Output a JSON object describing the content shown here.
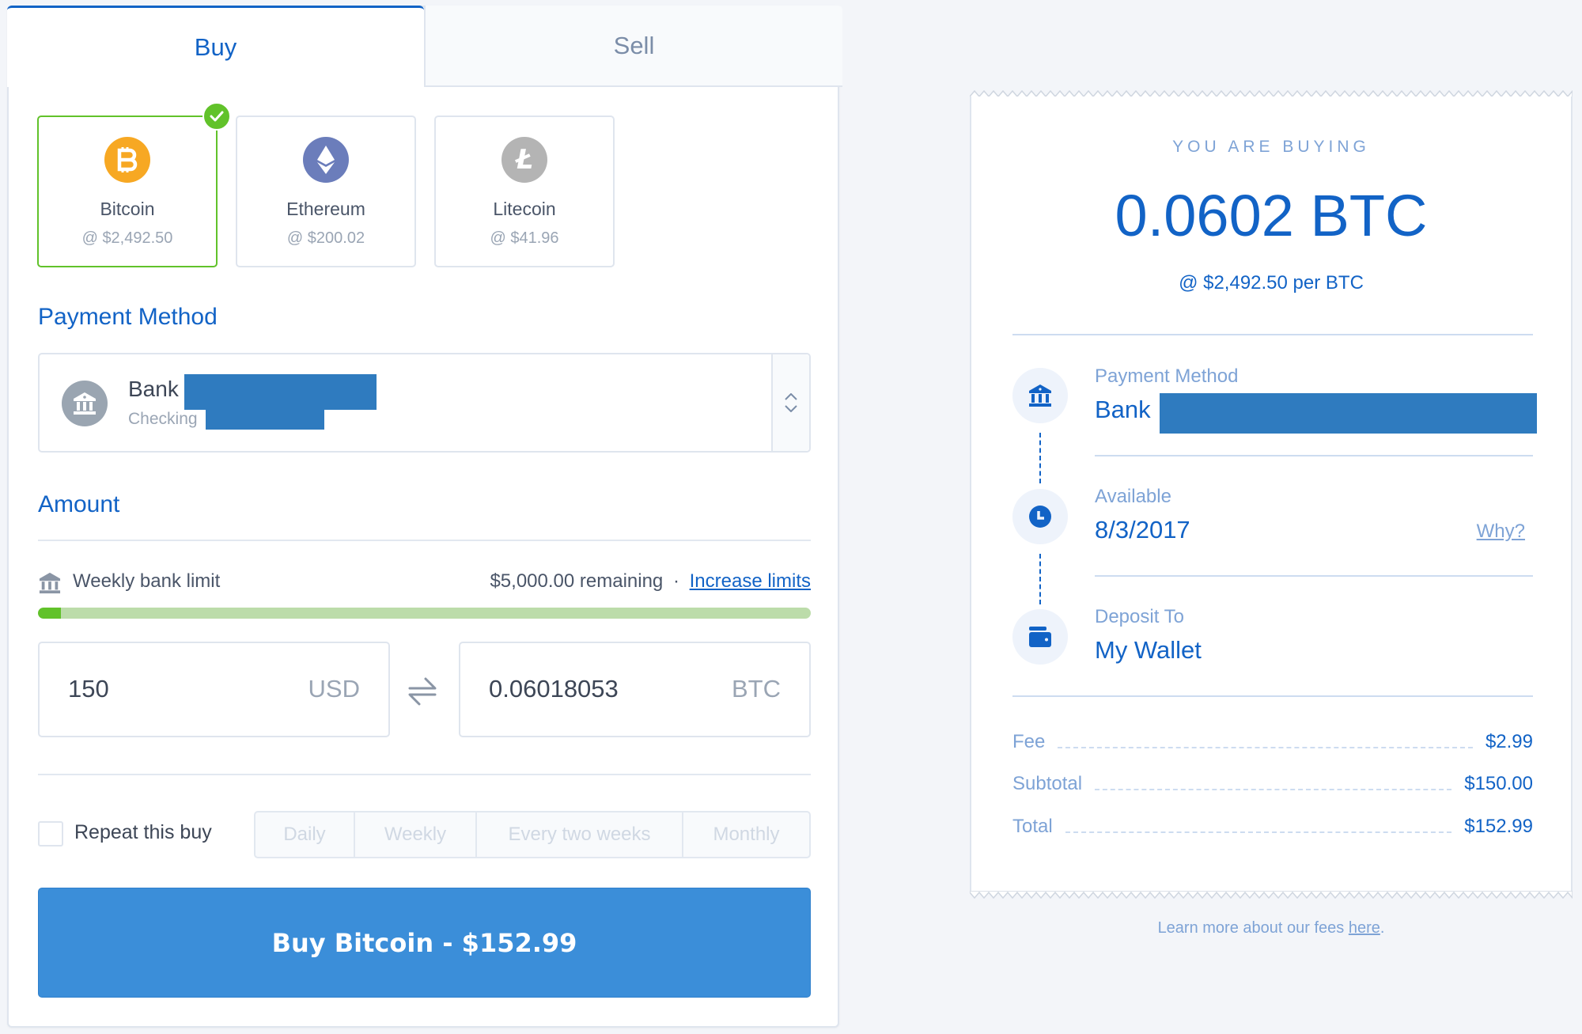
{
  "colors": {
    "accent": "#1263c6",
    "success": "#61c22a",
    "button": "#3b8ed9",
    "bitcoin": "#f7a823",
    "ethereum": "#6b7dbb",
    "litecoin": "#b4b4b4",
    "redaction": "#2f7bbf"
  },
  "tabs": [
    {
      "label": "Buy",
      "active": true
    },
    {
      "label": "Sell",
      "active": false
    }
  ],
  "coins": [
    {
      "name": "Bitcoin",
      "price": "@ $2,492.50",
      "icon": "bitcoin-icon",
      "glyph": "B",
      "selected": true
    },
    {
      "name": "Ethereum",
      "price": "@ $200.02",
      "icon": "ethereum-icon",
      "glyph": "◆",
      "selected": false
    },
    {
      "name": "Litecoin",
      "price": "@ $41.96",
      "icon": "litecoin-icon",
      "glyph": "Ł",
      "selected": false
    }
  ],
  "payment": {
    "title": "Payment Method",
    "bank_name": "Bank",
    "account_type": "Checking",
    "icon": "bank-icon"
  },
  "amount": {
    "title": "Amount",
    "limit_label": "Weekly bank limit",
    "limit_remaining": "$5,000.00 remaining",
    "separator": "·",
    "increase_link": "Increase limits",
    "limit_used_fraction": 0.03,
    "fiat_value": "150",
    "fiat_currency": "USD",
    "crypto_value": "0.06018053",
    "crypto_currency": "BTC"
  },
  "repeat": {
    "label": "Repeat this buy",
    "checked": false,
    "options": [
      "Daily",
      "Weekly",
      "Every two weeks",
      "Monthly"
    ]
  },
  "buy_button": "Buy Bitcoin - $152.99",
  "receipt": {
    "heading": "YOU ARE BUYING",
    "amount": "0.0602 BTC",
    "rate": "@ $2,492.50 per BTC",
    "steps": [
      {
        "label": "Payment Method",
        "value": "Bank",
        "icon": "bank-icon"
      },
      {
        "label": "Available",
        "value": "8/3/2017",
        "icon": "clock-icon",
        "link": "Why?"
      },
      {
        "label": "Deposit To",
        "value": "My Wallet",
        "icon": "wallet-icon"
      }
    ],
    "line_items": [
      {
        "label": "Fee",
        "value": "$2.99"
      },
      {
        "label": "Subtotal",
        "value": "$150.00"
      },
      {
        "label": "Total",
        "value": "$152.99"
      }
    ]
  },
  "footer": {
    "text": "Learn more about our fees ",
    "link": "here",
    "suffix": "."
  }
}
